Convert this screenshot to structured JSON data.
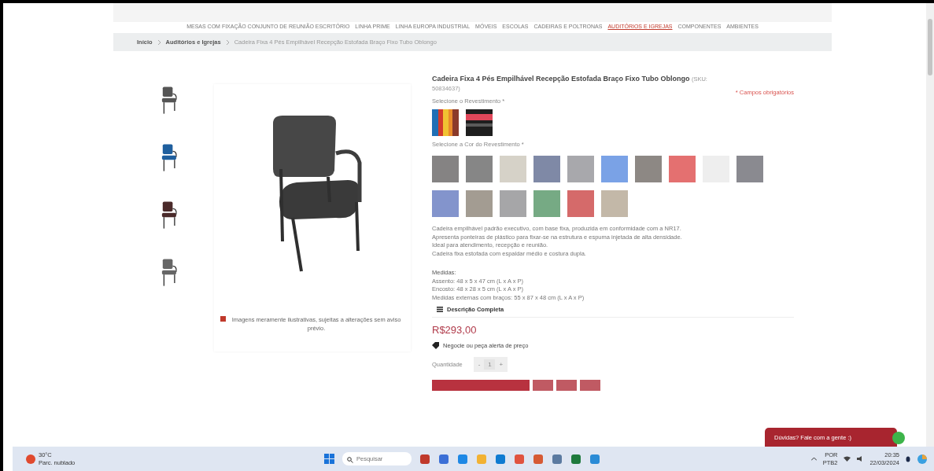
{
  "nav": [
    {
      "label": "MESAS COM FIXAÇÃO CONJUNTO DE REUNIÃO ESCRITÓRIO",
      "selected": false
    },
    {
      "label": "LINHA PRIME",
      "selected": false
    },
    {
      "label": "LINHA EUROPA INDUSTRIAL",
      "selected": false
    },
    {
      "label": "MÓVEIS",
      "selected": false
    },
    {
      "label": "ESCOLAS",
      "selected": false
    },
    {
      "label": "CADEIRAS E POLTRONAS",
      "selected": false
    },
    {
      "label": "AUDITÓRIOS E IGREJAS",
      "selected": true
    },
    {
      "label": "COMPONENTES",
      "selected": false
    },
    {
      "label": "AMBIENTES",
      "selected": false
    }
  ],
  "breadcrumb": [
    "Início",
    "Auditórios e Igrejas",
    "Cadeira Fixa 4 Pés Empilhável Recepção Estofada Braço Fixo Tubo Oblongo"
  ],
  "thumbnails": [
    {
      "kind": "picture"
    },
    {
      "kind": "picture"
    },
    {
      "kind": "picture"
    },
    {
      "kind": "picture"
    }
  ],
  "image_note": "Imagens meramente ilustrativas, sujeitas a alterações sem aviso prévio.",
  "product": {
    "title": "Cadeira Fixa 4 Pés Empilhável Recepção Estofada Braço Fixo Tubo Oblongo",
    "sku": "(SKU: 50834637)",
    "required_note": "* Campos obrigatórios",
    "covering_label": "Selecione o Revestimento *",
    "coverings": [
      {
        "kind": "picture"
      },
      {
        "kind": "picture"
      }
    ],
    "color_label": "Selecione a Cor do Revestimento *",
    "colors": [
      {
        "color": "#858383"
      },
      {
        "color": "#868686"
      },
      {
        "color": "#d6d2c8"
      },
      {
        "color": "#7f89a6"
      },
      {
        "color": "#a8a8ac"
      },
      {
        "color": "#7aa2e6"
      },
      {
        "color": "#8d8884"
      },
      {
        "color": "#e47070"
      },
      {
        "color": "#eeeeee"
      },
      {
        "color": "#8a8a90"
      },
      {
        "color": "#8394cc"
      },
      {
        "color": "#a39c92"
      },
      {
        "color": "#a6a6a8"
      },
      {
        "color": "#76aa84"
      },
      {
        "color": "#d56a6a"
      },
      {
        "color": "#c3b8a8"
      }
    ],
    "description": [
      "Cadeira empilhável padrão executivo, com base fixa, produzida em conformidade com a NR17.",
      "Apresenta ponteiras de plástico para fixar-se na estrutura e espuma injetada de alta densidade.",
      "Ideal para atendimento, recepção e reunião.",
      "Cadeira fixa estofada com espaldar médio e costura dupla."
    ],
    "measures_title": "Medidas:",
    "measures": [
      "Assento: 48 x 5 x 47 cm (L x A x P)",
      "Encosto: 48 x 28 x 5 cm (L x A x P)",
      "Medidas externas com braços: 55 x 87 x 48 cm (L x A x P)"
    ],
    "full_description": "Descrição Completa",
    "price": "R$293,00",
    "negotiate": "Negocie ou peça alerta de preço",
    "quantity_label": "Quantidade",
    "quantity": {
      "minus": "-",
      "value": "1",
      "plus": "+"
    }
  },
  "chat": "Dúvidas? Fale com a gente :)",
  "taskbar": {
    "weather_temp": "30°C",
    "weather_text": "Parc. nublado",
    "search_placeholder": "Pesquisar",
    "lang_top": "POR",
    "lang_bottom": "PTB2",
    "time": "20:35",
    "date": "22/03/2024"
  }
}
